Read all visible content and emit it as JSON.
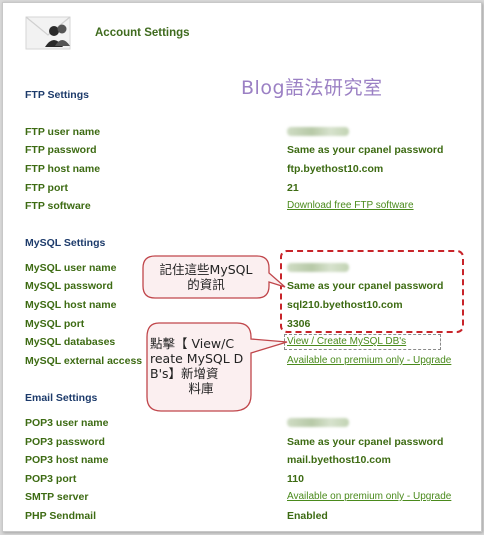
{
  "header": {
    "title": "Account Settings",
    "icon": "users-envelope-icon"
  },
  "watermark": "Blog語法研究室",
  "ftp": {
    "title": "FTP Settings",
    "rows": [
      {
        "label": "FTP user name"
      },
      {
        "label": "FTP password",
        "value": "Same as your cpanel password"
      },
      {
        "label": "FTP host name",
        "value": "ftp.byethost10.com"
      },
      {
        "label": "FTP port",
        "value": "21"
      },
      {
        "label": "FTP software",
        "link": "Download free FTP software"
      }
    ]
  },
  "mysql": {
    "title": "MySQL Settings",
    "rows": [
      {
        "label": "MySQL user name"
      },
      {
        "label": "MySQL password",
        "value": "Same as your cpanel password"
      },
      {
        "label": "MySQL host name",
        "value": "sql210.byethost10.com"
      },
      {
        "label": "MySQL port",
        "value": "3306"
      },
      {
        "label": "MySQL databases",
        "link": "View / Create MySQL DB's"
      },
      {
        "label": "MySQL external access",
        "link": "Available on premium only - Upgrade"
      }
    ]
  },
  "email": {
    "title": "Email Settings",
    "rows": [
      {
        "label": "POP3 user name"
      },
      {
        "label": "POP3 password",
        "value": "Same as your cpanel password"
      },
      {
        "label": "POP3 host name",
        "value": "mail.byethost10.com"
      },
      {
        "label": "POP3 port",
        "value": "110"
      },
      {
        "label": "SMTP server",
        "link": "Available on premium only - Upgrade"
      },
      {
        "label": "PHP Sendmail",
        "value": "Enabled"
      }
    ]
  },
  "annotations": {
    "callout1": [
      "記住這些MySQL",
      "的資訊"
    ],
    "callout2": [
      "點擊【 View/C",
      "reate MySQL D",
      "B's】新增資",
      "料庫"
    ]
  },
  "colors": {
    "label_green": "#3d6b13",
    "section_blue": "#1d3b6b",
    "dash_red": "#c8242a",
    "watermark": "#9b80c4"
  }
}
